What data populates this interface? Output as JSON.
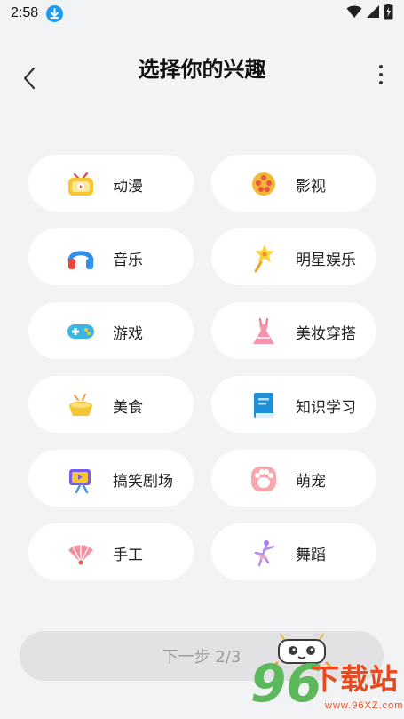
{
  "status_bar": {
    "time": "2:58",
    "download_icon": "download-icon",
    "icons": [
      "wifi-icon",
      "signal-icon",
      "battery-icon"
    ]
  },
  "header": {
    "title": "选择你的兴趣",
    "back_icon": "chevron-left-icon",
    "more_icon": "more-vertical-icon"
  },
  "interests": [
    {
      "label": "动漫",
      "icon": "anime-tv-icon"
    },
    {
      "label": "影视",
      "icon": "film-reel-icon"
    },
    {
      "label": "音乐",
      "icon": "headphones-icon"
    },
    {
      "label": "明星娱乐",
      "icon": "star-wand-icon"
    },
    {
      "label": "游戏",
      "icon": "gamepad-icon"
    },
    {
      "label": "美妆穿搭",
      "icon": "dress-icon"
    },
    {
      "label": "美食",
      "icon": "food-icon"
    },
    {
      "label": "知识学习",
      "icon": "book-icon"
    },
    {
      "label": "搞笑剧场",
      "icon": "clapper-icon"
    },
    {
      "label": "萌宠",
      "icon": "paw-icon"
    },
    {
      "label": "手工",
      "icon": "fan-icon"
    },
    {
      "label": "舞蹈",
      "icon": "dancer-icon"
    }
  ],
  "footer": {
    "next_label": "下一步 2/3"
  },
  "watermark": {
    "number": "96",
    "site": "下载站",
    "url": "www.96XZ.com"
  },
  "colors": {
    "background": "#f2f3f5",
    "chip": "#ffffff",
    "button_disabled": "#e2e2e4",
    "button_text_disabled": "#9b9b9f",
    "accent_blue": "#1e9af0"
  }
}
